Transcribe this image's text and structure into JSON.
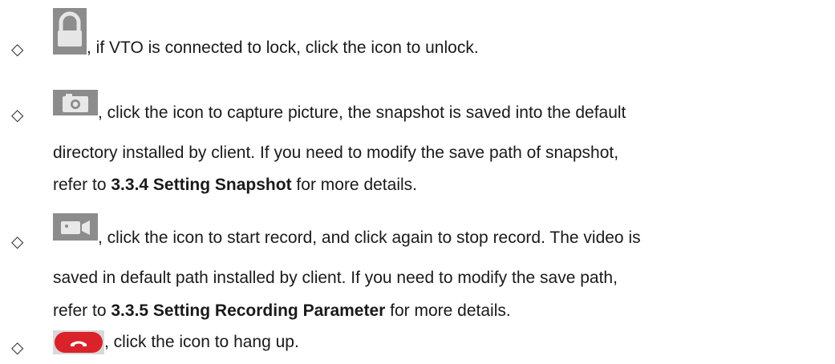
{
  "bullet_symbol": "◇",
  "items": [
    {
      "icon": "lock-icon",
      "text_1": ", if VTO is connected to lock, click the icon to unlock."
    },
    {
      "icon": "camera-icon",
      "text_1": ", click the icon to capture picture, the snapshot is saved into the default",
      "text_2": "directory installed by client. If you need to modify the save path of snapshot,",
      "text_3_pre": "refer to ",
      "text_3_bold": "3.3.4 Setting Snapshot",
      "text_3_post": " for more details."
    },
    {
      "icon": "video-record-icon",
      "text_1": ", click the icon to start record, and click again to stop record. The video is",
      "text_2": "saved in default path installed by client. If you need to modify the save path,",
      "text_3_pre": "refer to ",
      "text_3_bold": "3.3.5 Setting Recording Parameter",
      "text_3_post": " for more details."
    },
    {
      "icon": "hang-up-icon",
      "text_1": ", click the icon to hang up."
    }
  ],
  "colors": {
    "icon_gray": "#9a9a9a",
    "hangup_red": "#d9222a"
  }
}
